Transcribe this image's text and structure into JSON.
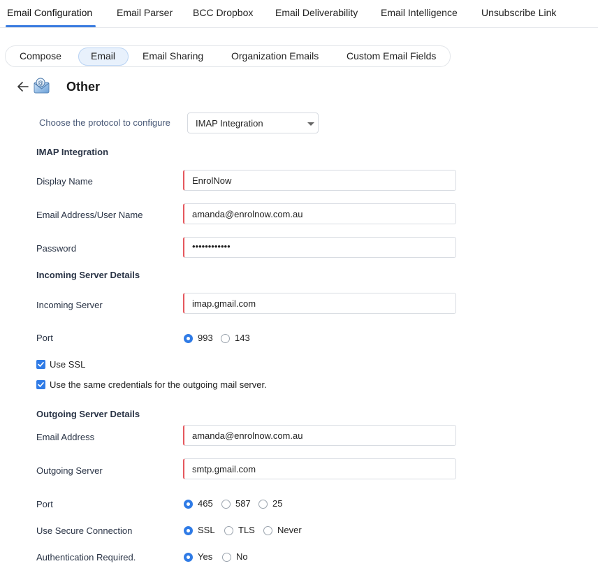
{
  "top_tabs": [
    "Email Configuration",
    "Email Parser",
    "BCC Dropbox",
    "Email Deliverability",
    "Email Intelligence",
    "Unsubscribe Link"
  ],
  "sub_tabs": [
    "Compose",
    "Email",
    "Email Sharing",
    "Organization Emails",
    "Custom Email Fields"
  ],
  "active_sub_tab": "Email",
  "header": {
    "title": "Other",
    "icons": [
      "back-arrow-icon",
      "mail-provider-icon"
    ]
  },
  "protocol": {
    "label": "Choose the protocol to configure",
    "selected": "IMAP Integration"
  },
  "imap": {
    "heading": "IMAP Integration",
    "display_name_label": "Display Name",
    "display_name_value": "EnrolNow",
    "email_label": "Email Address/User Name",
    "email_value": "amanda@enrolnow.com.au",
    "password_label": "Password",
    "password_value": "••••••••••••"
  },
  "incoming": {
    "heading": "Incoming Server Details",
    "server_label": "Incoming Server",
    "server_value": "imap.gmail.com",
    "port_label": "Port",
    "port_options": [
      "993",
      "143"
    ],
    "port_selected": "993",
    "use_ssl_label": "Use SSL",
    "use_ssl_checked": true,
    "same_creds_label": "Use the same credentials for the outgoing mail server.",
    "same_creds_checked": true
  },
  "outgoing": {
    "heading": "Outgoing Server Details",
    "email_label": "Email Address",
    "email_value": "amanda@enrolnow.com.au",
    "server_label": "Outgoing Server",
    "server_value": "smtp.gmail.com",
    "port_label": "Port",
    "port_options": [
      "465",
      "587",
      "25"
    ],
    "port_selected": "465",
    "secure_label": "Use Secure Connection",
    "secure_options": [
      "SSL",
      "TLS",
      "Never"
    ],
    "secure_selected": "SSL",
    "auth_label": "Authentication Required.",
    "auth_options": [
      "Yes",
      "No"
    ],
    "auth_selected": "Yes"
  },
  "colors": {
    "accent": "#2f7be6",
    "required_marker": "#e5575d",
    "active_pill_bg": "#e8f1fc"
  }
}
